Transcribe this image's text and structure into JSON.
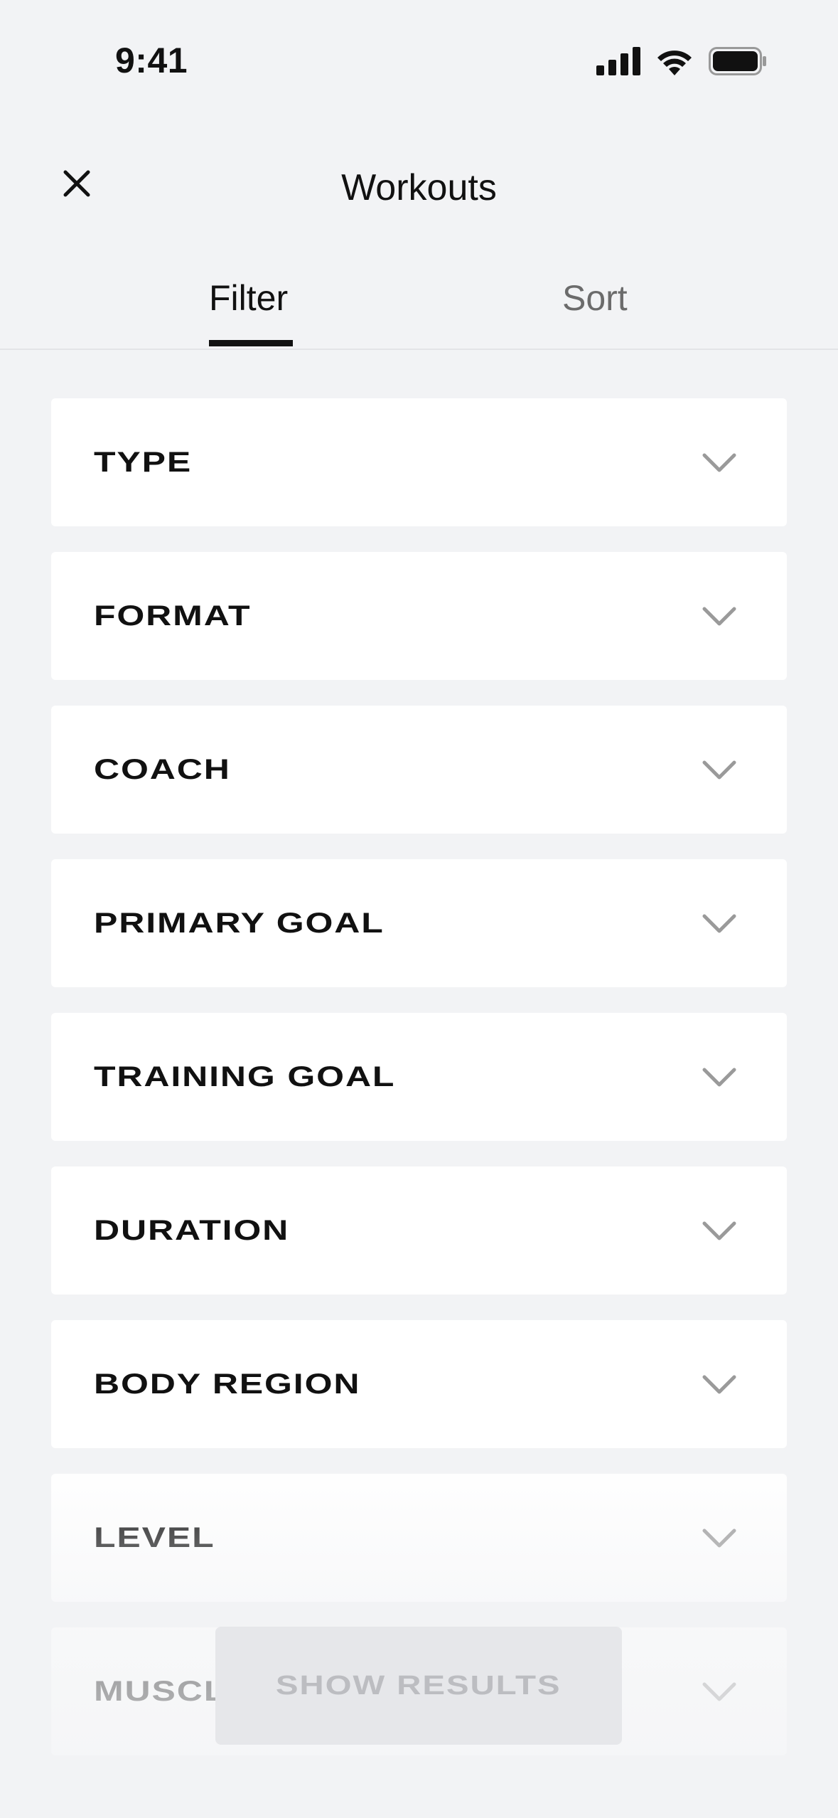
{
  "status": {
    "time": "9:41"
  },
  "header": {
    "title": "Workouts",
    "close_icon": "close-icon"
  },
  "tabs": [
    {
      "label": "Filter",
      "active": true
    },
    {
      "label": "Sort",
      "active": false
    }
  ],
  "filters": [
    {
      "label": "TYPE"
    },
    {
      "label": "FORMAT"
    },
    {
      "label": "COACH"
    },
    {
      "label": "PRIMARY GOAL"
    },
    {
      "label": "TRAINING GOAL"
    },
    {
      "label": "DURATION"
    },
    {
      "label": "BODY REGION"
    },
    {
      "label": "LEVEL"
    },
    {
      "label": "MUSCL"
    }
  ],
  "footer": {
    "show_results_label": "SHOW RESULTS"
  },
  "colors": {
    "background": "#f2f3f5",
    "card": "#ffffff",
    "text": "#111111",
    "chevron": "#9a9a9a",
    "button_disabled": "#e6e7ea"
  }
}
